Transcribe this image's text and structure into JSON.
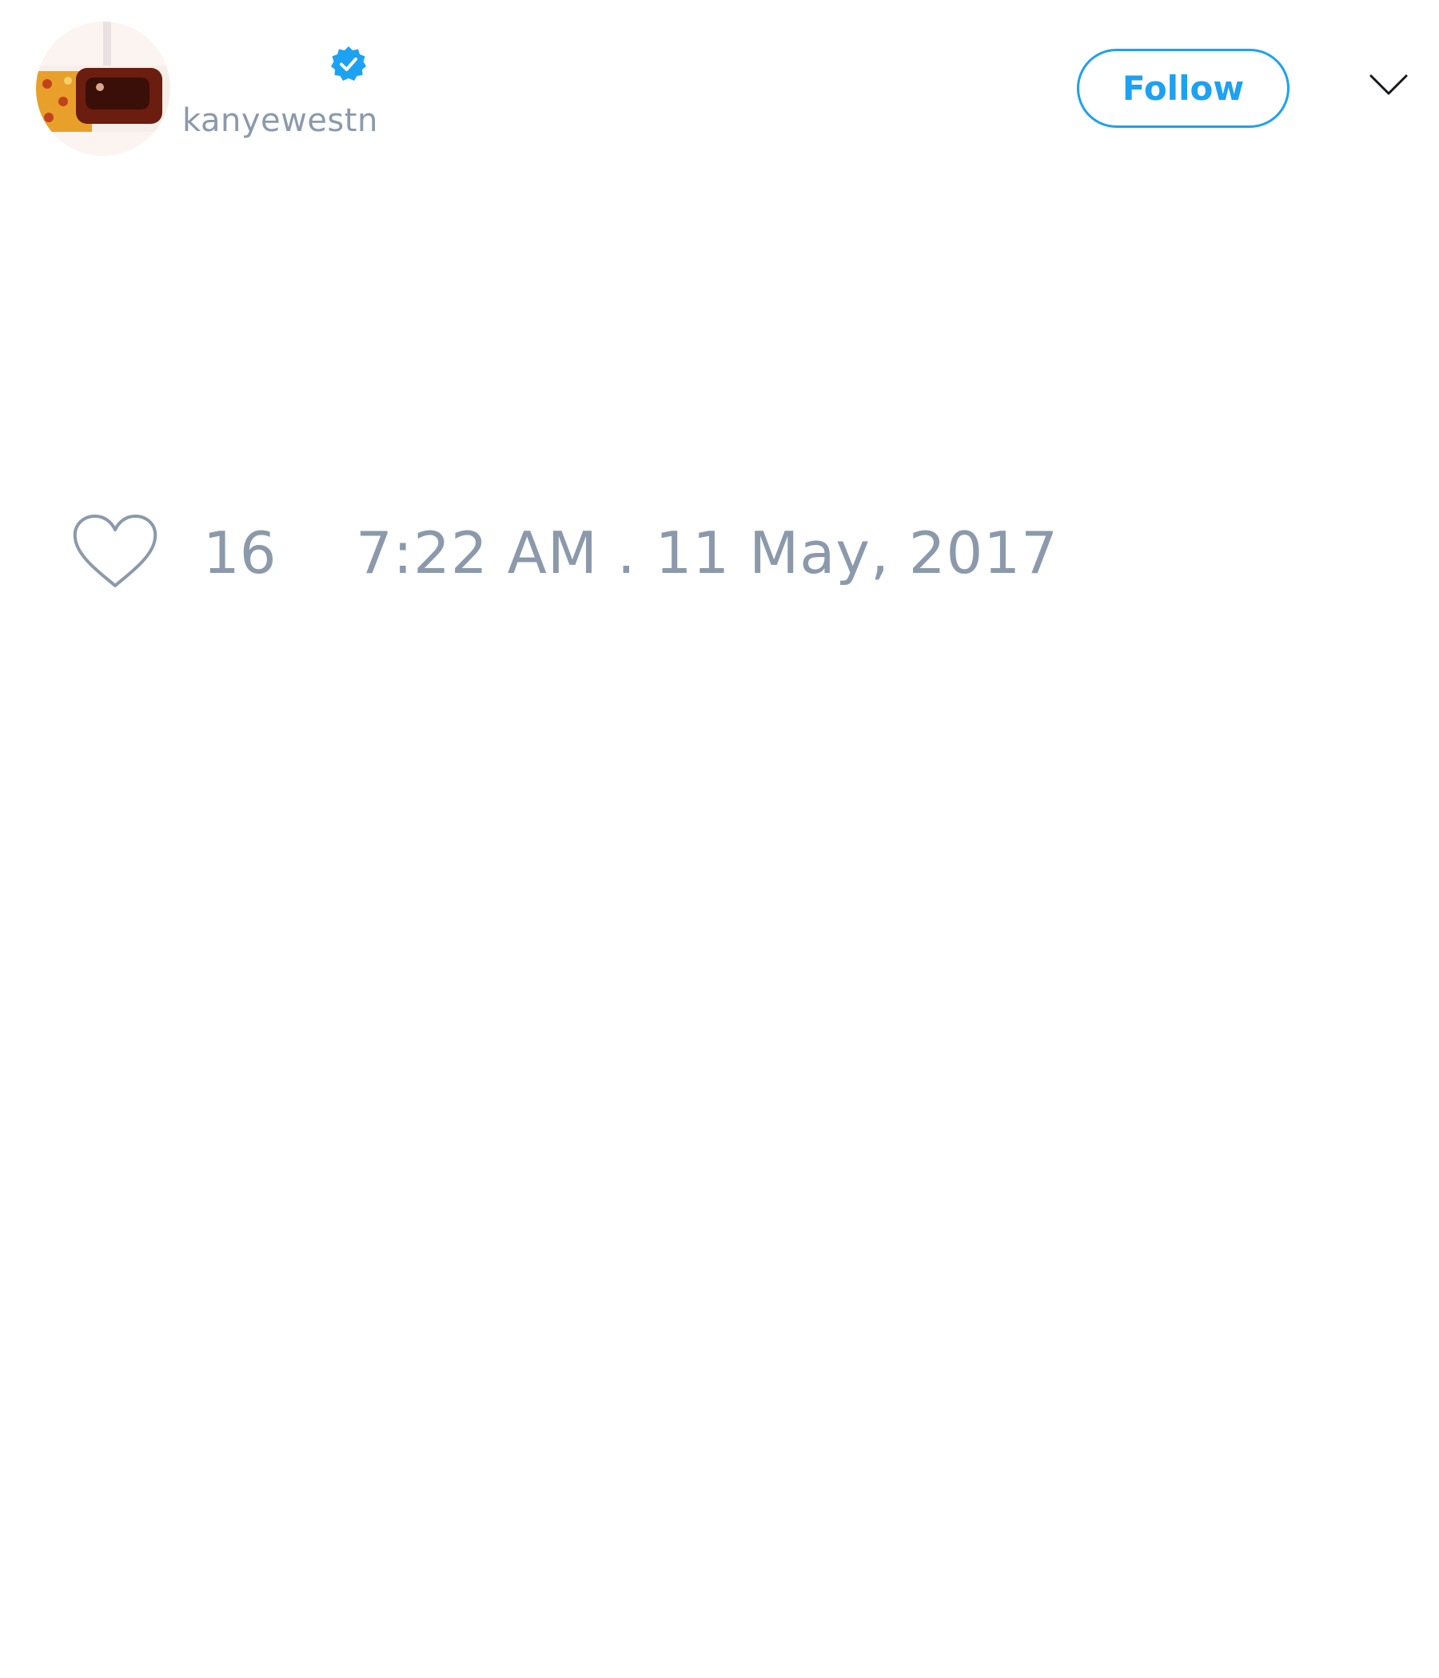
{
  "tweet": {
    "author": {
      "display_name": "",
      "username": "kanyewestn",
      "verified": true,
      "verified_icon": "verified-badge-icon",
      "avatar_icon": "avatar-image"
    },
    "header": {
      "follow_label": "Follow",
      "more_icon": "chevron-down-icon"
    },
    "footer": {
      "like_icon": "heart-icon",
      "like_count": "16",
      "timestamp": "7:22 AM . 11 May, 2017"
    }
  },
  "colors": {
    "accent": "#1da1f2",
    "muted_text": "#8b99ab",
    "background": "#ffffff"
  }
}
